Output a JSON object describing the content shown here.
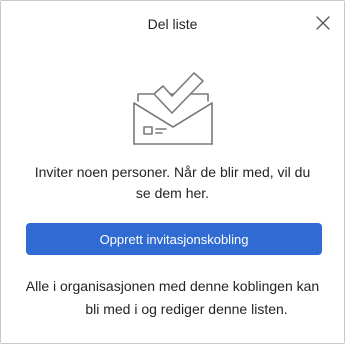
{
  "dialog": {
    "title": "Del liste",
    "close_icon": "close-icon",
    "illustration_icon": "envelope-checkmark-illustration",
    "message": "Inviter noen personer. Når de blir med, vil du se dem her.",
    "primary_button_label": "Opprett invitasjonskobling",
    "note_line1": "Alle i organisasjonen med denne koblingen kan",
    "note_line2": "bli med i og rediger denne listen."
  },
  "colors": {
    "accent": "#2f6bd3",
    "text": "#242424",
    "illustration_stroke": "#7a7a7a"
  }
}
